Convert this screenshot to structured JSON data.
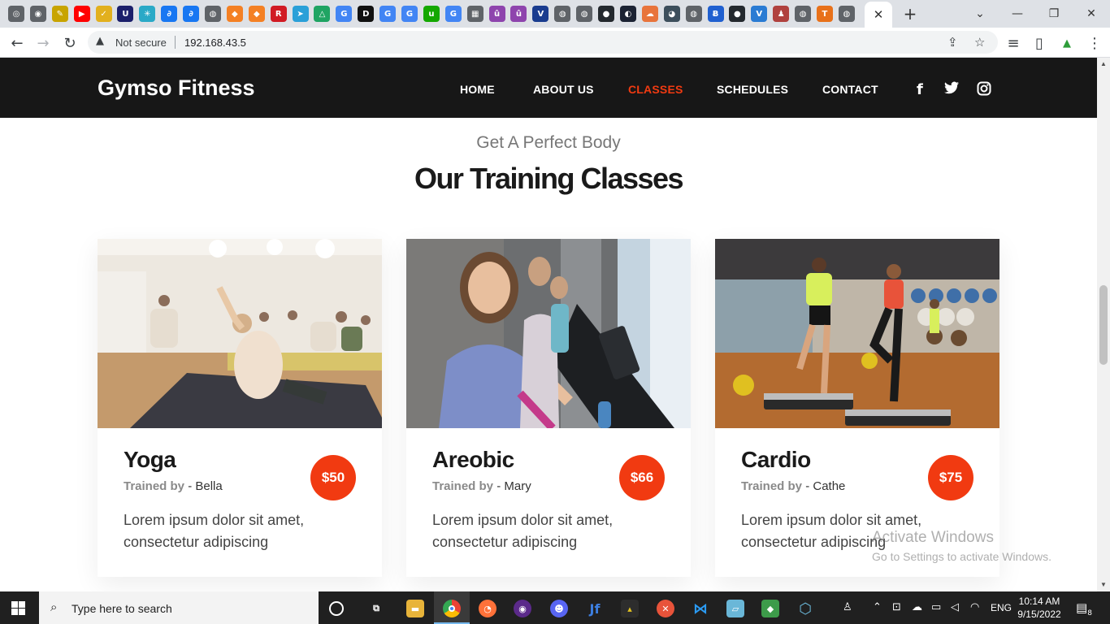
{
  "browser": {
    "tab_icons": [
      {
        "name": "tab-icon-1",
        "color": "#5f6368",
        "glyph": "◎"
      },
      {
        "name": "tab-icon-2",
        "color": "#5f6368",
        "glyph": "◉"
      },
      {
        "name": "tab-icon-3",
        "color": "#c8a400",
        "glyph": "✎"
      },
      {
        "name": "tab-icon-youtube",
        "color": "#ff0000",
        "glyph": "▶"
      },
      {
        "name": "tab-icon-5",
        "color": "#e2b01e",
        "glyph": "✓"
      },
      {
        "name": "tab-icon-6",
        "color": "#1b1f6b",
        "glyph": "U"
      },
      {
        "name": "tab-icon-7",
        "color": "#2aa9c7",
        "glyph": "✳"
      },
      {
        "name": "tab-icon-8",
        "color": "#1877f2",
        "glyph": "∂"
      },
      {
        "name": "tab-icon-9",
        "color": "#1877f2",
        "glyph": "∂"
      },
      {
        "name": "tab-icon-10",
        "color": "#5f6368",
        "glyph": "◍"
      },
      {
        "name": "tab-icon-11",
        "color": "#f48024",
        "glyph": "◆"
      },
      {
        "name": "tab-icon-12",
        "color": "#f48024",
        "glyph": "◆"
      },
      {
        "name": "tab-icon-13",
        "color": "#d11b24",
        "glyph": "R"
      },
      {
        "name": "tab-icon-telegram",
        "color": "#2aa0d8",
        "glyph": "➤"
      },
      {
        "name": "tab-icon-drive",
        "color": "#1fa463",
        "glyph": "△"
      },
      {
        "name": "tab-icon-google-1",
        "color": "#4285f4",
        "glyph": "G"
      },
      {
        "name": "tab-icon-dev",
        "color": "#111111",
        "glyph": "D"
      },
      {
        "name": "tab-icon-google-2",
        "color": "#4285f4",
        "glyph": "G"
      },
      {
        "name": "tab-icon-google-3",
        "color": "#4285f4",
        "glyph": "G"
      },
      {
        "name": "tab-icon-upwork",
        "color": "#14a800",
        "glyph": "u"
      },
      {
        "name": "tab-icon-google-4",
        "color": "#4285f4",
        "glyph": "G"
      },
      {
        "name": "tab-icon-22",
        "color": "#5f6368",
        "glyph": "▦"
      },
      {
        "name": "tab-icon-23",
        "color": "#8e44ad",
        "glyph": "û"
      },
      {
        "name": "tab-icon-24",
        "color": "#8e44ad",
        "glyph": "û"
      },
      {
        "name": "tab-icon-25",
        "color": "#1a3c8f",
        "glyph": "V"
      },
      {
        "name": "tab-icon-26",
        "color": "#5f6368",
        "glyph": "◍"
      },
      {
        "name": "tab-icon-27",
        "color": "#5f6368",
        "glyph": "◍"
      },
      {
        "name": "tab-icon-github-1",
        "color": "#24292e",
        "glyph": "●"
      },
      {
        "name": "tab-icon-29",
        "color": "#1c2333",
        "glyph": "◐"
      },
      {
        "name": "tab-icon-30",
        "color": "#e8743b",
        "glyph": "☁"
      },
      {
        "name": "tab-icon-31",
        "color": "#3d4f5c",
        "glyph": "◕"
      },
      {
        "name": "tab-icon-32",
        "color": "#5f6368",
        "glyph": "◍"
      },
      {
        "name": "tab-icon-33",
        "color": "#2060d0",
        "glyph": "Ƀ"
      },
      {
        "name": "tab-icon-github-2",
        "color": "#24292e",
        "glyph": "●"
      },
      {
        "name": "tab-icon-35",
        "color": "#2a7bd3",
        "glyph": "V"
      },
      {
        "name": "tab-icon-36",
        "color": "#b0413e",
        "glyph": "♟"
      },
      {
        "name": "tab-icon-37",
        "color": "#5f6368",
        "glyph": "◍"
      },
      {
        "name": "tab-icon-38",
        "color": "#e8711a",
        "glyph": "T"
      },
      {
        "name": "tab-icon-39",
        "color": "#5f6368",
        "glyph": "◍"
      }
    ],
    "active_tab_close": "✕",
    "new_tab": "+",
    "address": {
      "security_text": "Not secure",
      "url": "192.168.43.5"
    }
  },
  "site": {
    "brand": "Gymso Fitness",
    "nav": [
      "HOME",
      "ABOUT US",
      "CLASSES",
      "SCHEDULES",
      "CONTACT"
    ],
    "active_nav": "CLASSES",
    "accent_color": "#f13a11",
    "social": [
      "facebook-icon",
      "twitter-icon",
      "instagram-icon"
    ]
  },
  "section": {
    "subtitle": "Get A Perfect Body",
    "title": "Our Training Classes"
  },
  "classes": [
    {
      "title": "Yoga",
      "trained_by_label": "Trained by",
      "trainer": " - Bella",
      "price": "$50",
      "description": "Lorem ipsum dolor sit amet, consectetur adipiscing"
    },
    {
      "title": "Areobic",
      "trained_by_label": "Trained by",
      "trainer": " - Mary",
      "price": "$66",
      "description": "Lorem ipsum dolor sit amet, consectetur adipiscing"
    },
    {
      "title": "Cardio",
      "trained_by_label": "Trained by",
      "trainer": " - Cathe",
      "price": "$75",
      "description": "Lorem ipsum dolor sit amet, consectetur adipiscing"
    }
  ],
  "watermark": {
    "line1": "Activate Windows",
    "line2": "Go to Settings to activate Windows."
  },
  "taskbar": {
    "search_placeholder": "Type here to search",
    "language": "ENG",
    "time": "10:14 AM",
    "date": "9/15/2022",
    "notification_count": "8"
  }
}
